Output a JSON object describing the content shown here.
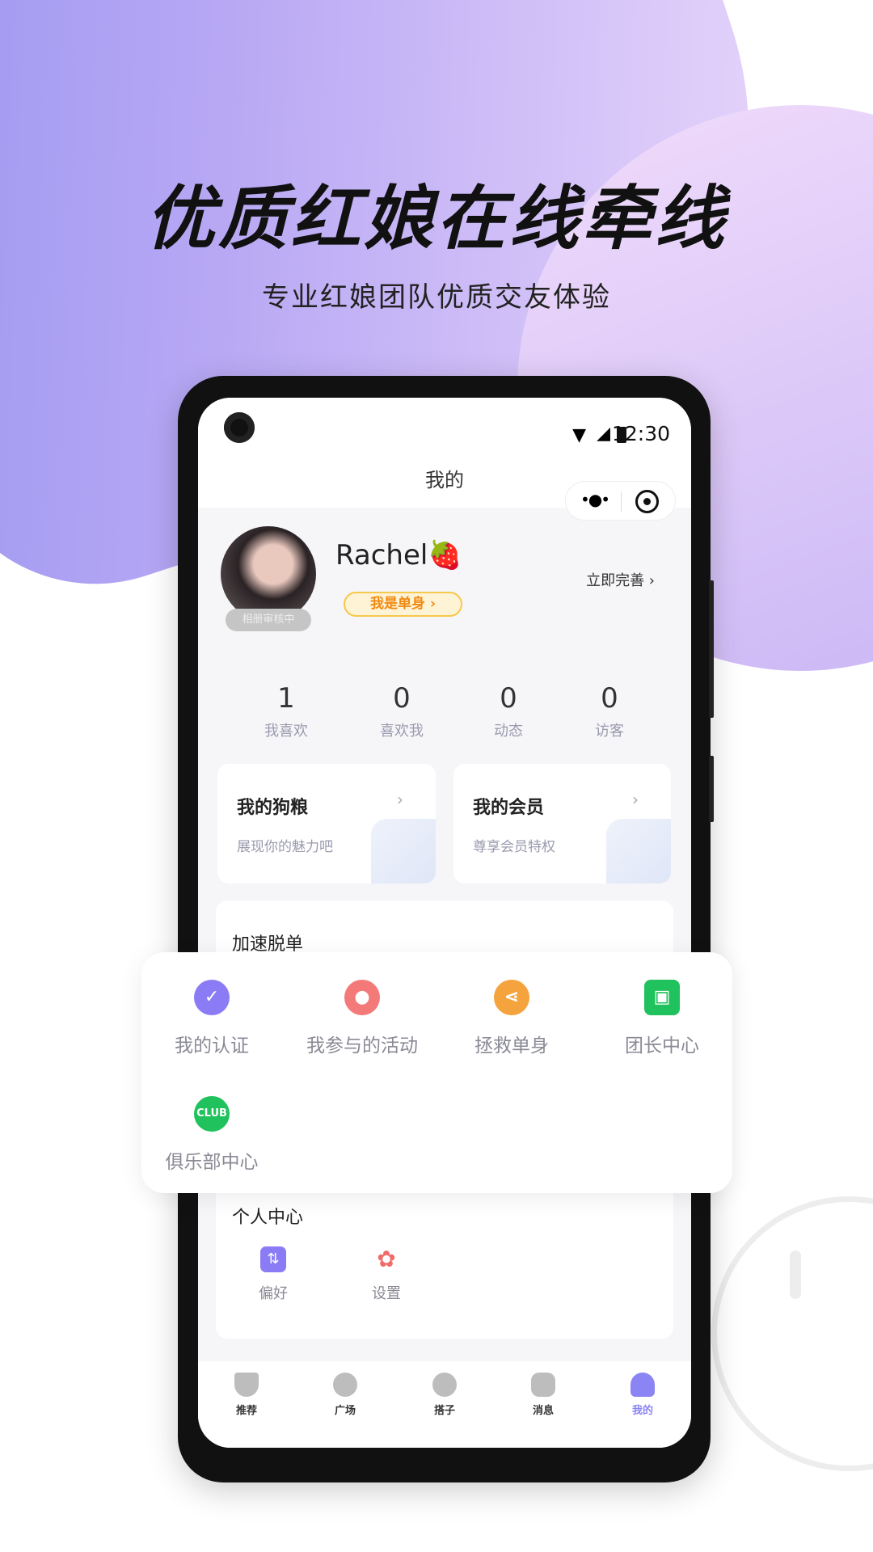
{
  "promo": {
    "title": "优质红娘在线牵线",
    "subtitle": "专业红娘团队优质交友体验"
  },
  "status_bar": {
    "time": "12:30"
  },
  "header": {
    "title": "我的"
  },
  "profile": {
    "name": "Rachel🍓",
    "avatar_status": "相册审核中",
    "single_tag": "我是单身 ›",
    "complete_link": "立即完善 ›"
  },
  "stats": [
    {
      "value": "1",
      "label": "我喜欢"
    },
    {
      "value": "0",
      "label": "喜欢我"
    },
    {
      "value": "0",
      "label": "动态"
    },
    {
      "value": "0",
      "label": "访客"
    }
  ],
  "cards": [
    {
      "title": "我的狗粮",
      "desc": "展现你的魅力吧",
      "chevron": "›"
    },
    {
      "title": "我的会员",
      "desc": "尊享会员特权",
      "chevron": "›"
    }
  ],
  "speed_section": {
    "title": "加速脱单"
  },
  "features": [
    {
      "label": "我的认证",
      "icon": "verified-badge-icon",
      "color": "#8b7cf6",
      "glyph": "✓"
    },
    {
      "label": "我参与的活动",
      "icon": "balloon-icon",
      "color": "#f47a7a",
      "glyph": "●"
    },
    {
      "label": "拯救单身",
      "icon": "share-icon",
      "color": "#f5a33c",
      "glyph": "⋖"
    },
    {
      "label": "团长中心",
      "icon": "leader-icon",
      "color": "#1fc25c",
      "glyph": "▣"
    },
    {
      "label": "俱乐部中心",
      "icon": "club-icon",
      "color": "#1fc25c",
      "glyph": "CLUB"
    }
  ],
  "personal": {
    "title": "个人中心",
    "items": [
      {
        "label": "偏好",
        "icon": "preference-icon",
        "color": "#8b7cf6",
        "glyph": "⇅"
      },
      {
        "label": "设置",
        "icon": "gear-icon",
        "color": "#f26b6b",
        "glyph": "✿"
      }
    ]
  },
  "tabs": [
    {
      "label": "推荐",
      "icon": "recommend-icon",
      "active": false
    },
    {
      "label": "广场",
      "icon": "planet-icon",
      "active": false
    },
    {
      "label": "搭子",
      "icon": "heart-icon",
      "active": false
    },
    {
      "label": "消息",
      "icon": "message-icon",
      "active": false
    },
    {
      "label": "我的",
      "icon": "profile-icon",
      "active": true
    }
  ],
  "colors": {
    "accent": "#8b84f5",
    "tag_orange": "#f08a12"
  }
}
